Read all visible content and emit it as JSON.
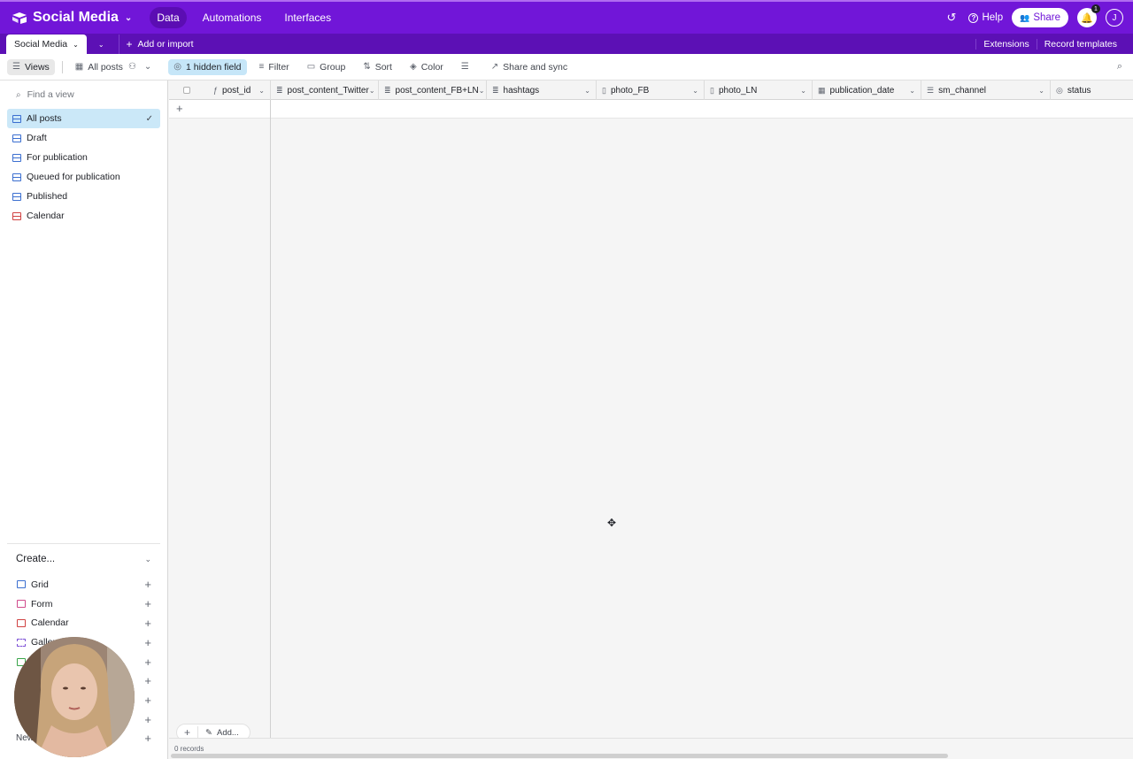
{
  "topbar": {
    "base_name": "Social Media",
    "nav": [
      "Data",
      "Automations",
      "Interfaces"
    ],
    "help": "Help",
    "share": "Share",
    "notification_count": "1",
    "user_initial": "J"
  },
  "tabbar": {
    "table_tab": "Social Media",
    "add_import": "Add or import",
    "extensions": "Extensions",
    "record_templates": "Record templates"
  },
  "viewbar": {
    "views": "Views",
    "current_view": "All posts",
    "hidden_field": "1 hidden field",
    "filter": "Filter",
    "group": "Group",
    "sort": "Sort",
    "color": "Color",
    "share_sync": "Share and sync"
  },
  "sidebar": {
    "find_placeholder": "Find a view",
    "views": [
      {
        "label": "All posts",
        "type": "grid",
        "active": true
      },
      {
        "label": "Draft",
        "type": "grid"
      },
      {
        "label": "For publication",
        "type": "grid"
      },
      {
        "label": "Queued for publication",
        "type": "grid"
      },
      {
        "label": "Published",
        "type": "grid"
      },
      {
        "label": "Calendar",
        "type": "calendar"
      }
    ],
    "create_title": "Create...",
    "create_items": [
      "Grid",
      "Form",
      "Calendar",
      "Galler"
    ],
    "new_label": "New"
  },
  "grid": {
    "columns": [
      {
        "name": "post_id",
        "icon": "formula-icon"
      },
      {
        "name": "post_content_Twitter",
        "icon": "long-text-icon"
      },
      {
        "name": "post_content_FB+LN",
        "icon": "long-text-icon"
      },
      {
        "name": "hashtags",
        "icon": "long-text-icon"
      },
      {
        "name": "photo_FB",
        "icon": "attachment-icon"
      },
      {
        "name": "photo_LN",
        "icon": "attachment-icon"
      },
      {
        "name": "publication_date",
        "icon": "date-icon"
      },
      {
        "name": "sm_channel",
        "icon": "multi-select-icon"
      },
      {
        "name": "status",
        "icon": "single-select-icon"
      }
    ],
    "add_label": "Add...",
    "records": "0 records"
  }
}
